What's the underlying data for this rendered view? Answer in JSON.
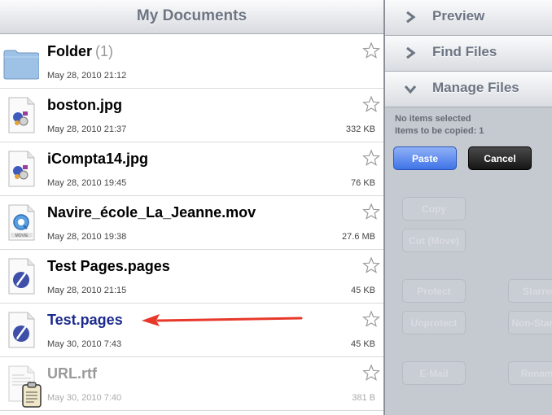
{
  "left": {
    "title": "My Documents",
    "files": [
      {
        "name": "Folder",
        "count": "(1)",
        "date": "May 28, 2010 21:12",
        "size": "",
        "icon": "folder-icon"
      },
      {
        "name": "boston.jpg",
        "date": "May 28, 2010 21:37",
        "size": "332 KB",
        "icon": "image-file-icon"
      },
      {
        "name": "iCompta14.jpg",
        "date": "May 28, 2010 19:45",
        "size": "76 KB",
        "icon": "image-file-icon"
      },
      {
        "name": "Navire_école_La_Jeanne.mov",
        "date": "May 28, 2010 19:38",
        "size": "27.6 MB",
        "icon": "movie-file-icon"
      },
      {
        "name": "Test Pages.pages",
        "date": "May 28, 2010 21:15",
        "size": "45 KB",
        "icon": "pages-file-icon"
      },
      {
        "name": "Test.pages",
        "date": "May 30, 2010 7:43",
        "size": "45 KB",
        "icon": "pages-file-icon"
      },
      {
        "name": "URL.rtf",
        "date": "May 30, 2010 7:40",
        "size": "381 B",
        "icon": "text-file-icon"
      }
    ]
  },
  "right": {
    "sections": [
      "Preview",
      "Find Files",
      "Manage Files"
    ],
    "status_selected": "No items selected",
    "status_copied": "Items to be copied: 1",
    "paste": "Paste",
    "cancel": "Cancel",
    "actions": {
      "copy": "Copy",
      "cut": "Cut (Move)",
      "protect": "Protect",
      "unprotect": "Unprotect",
      "email": "E-Mail",
      "starred": "Starred",
      "non_starred": "Non-Starred",
      "rename": "Rename"
    }
  },
  "colors": {
    "accent_blue": "#3f74e7",
    "arrow_red": "#e8382a",
    "selected_text": "#1c2b8c"
  }
}
